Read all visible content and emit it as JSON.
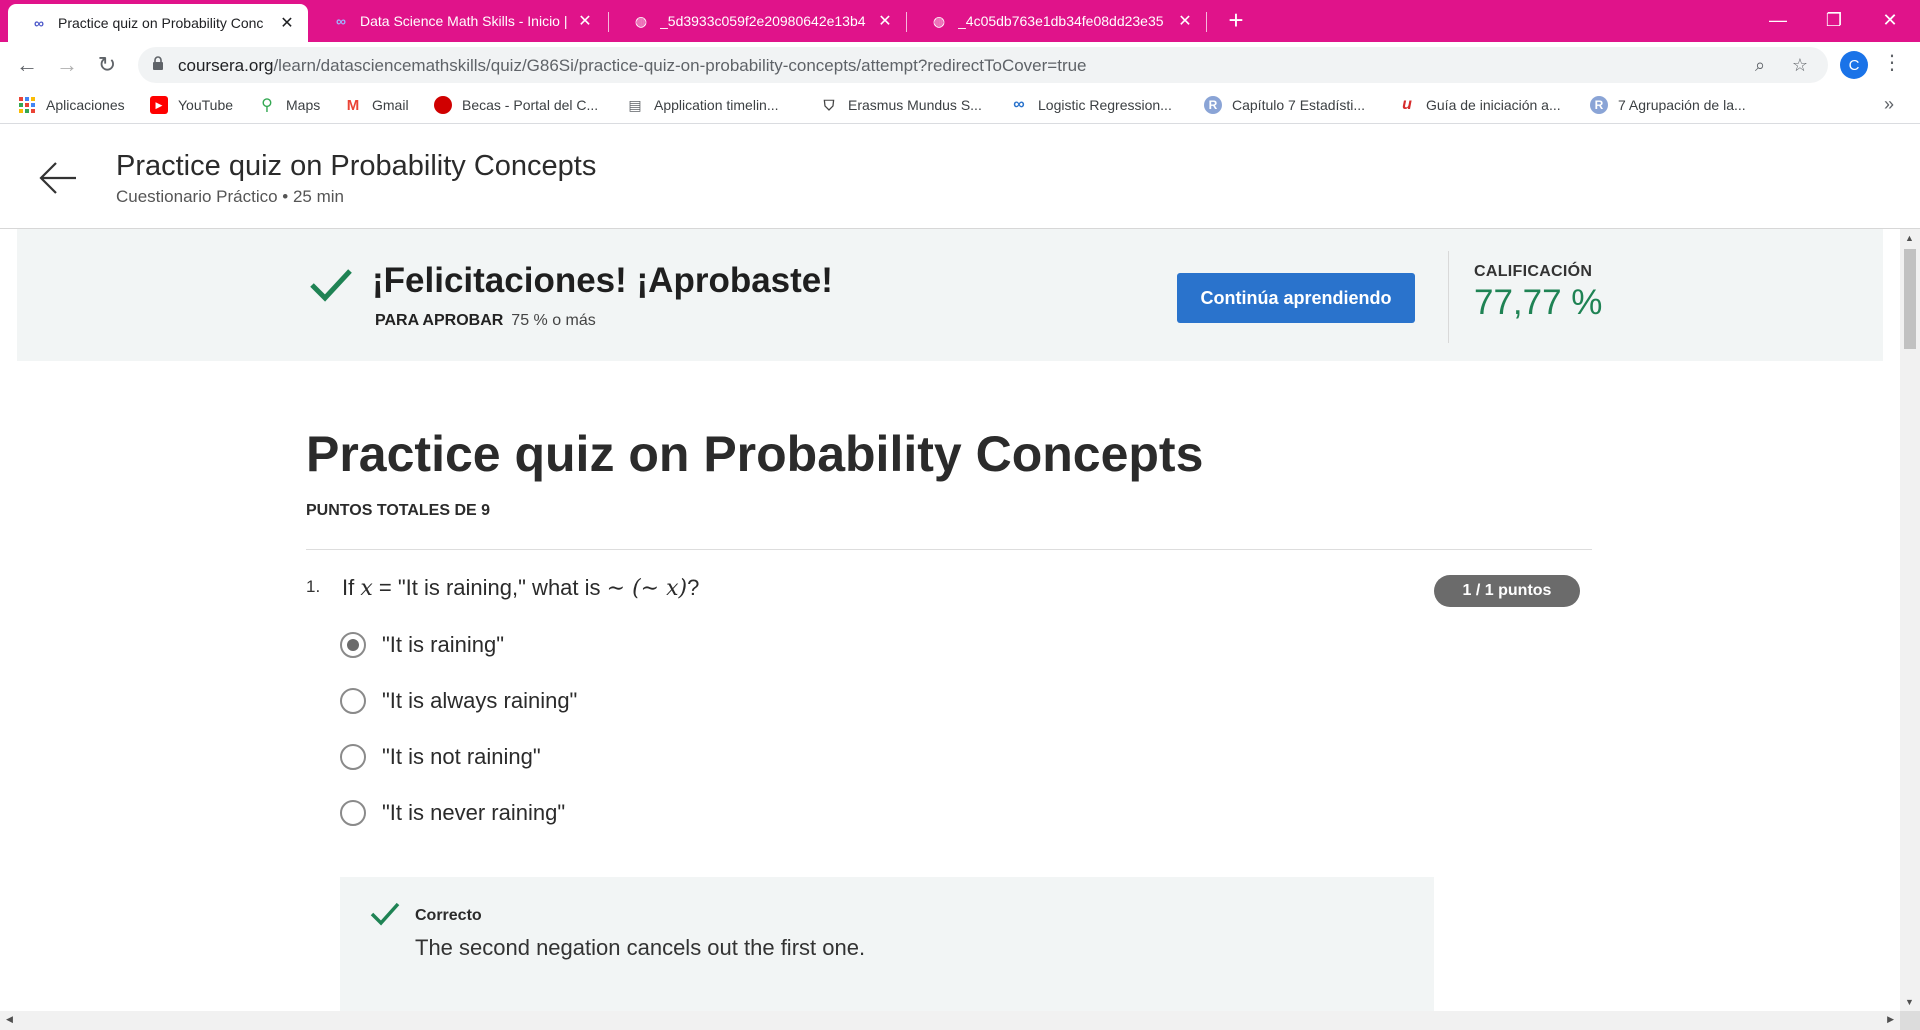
{
  "browser": {
    "tabs": [
      {
        "title": "Practice quiz on Probability Conc",
        "icon": "coursera-icon",
        "active": true
      },
      {
        "title": "Data Science Math Skills - Inicio |",
        "icon": "coursera-icon",
        "active": false
      },
      {
        "title": "_5d3933c059f2e20980642e13b4",
        "icon": "globe-icon",
        "active": false
      },
      {
        "title": "_4c05db763e1db34fe08dd23e35",
        "icon": "globe-icon",
        "active": false
      }
    ],
    "url_host": "coursera.org",
    "url_path": "/learn/datasciencemathskills/quiz/G86Si/practice-quiz-on-probability-concepts/attempt?redirectToCover=true",
    "profile_initial": "C",
    "accent_color": "#e0138a"
  },
  "bookmarks": [
    {
      "label": "Aplicaciones",
      "icon": "apps-grid-icon"
    },
    {
      "label": "YouTube",
      "icon": "youtube-icon"
    },
    {
      "label": "Maps",
      "icon": "maps-pin-icon"
    },
    {
      "label": "Gmail",
      "icon": "gmail-icon"
    },
    {
      "label": "Becas - Portal del C...",
      "icon": "red-circle-icon"
    },
    {
      "label": "Application timelin...",
      "icon": "document-icon"
    },
    {
      "label": "Erasmus Mundus S...",
      "icon": "shield-icon"
    },
    {
      "label": "Logistic Regression...",
      "icon": "coursera-icon"
    },
    {
      "label": "Capítulo 7 Estadísti...",
      "icon": "r-circle-icon"
    },
    {
      "label": "Guía de iniciación a...",
      "icon": "u-logo-icon"
    },
    {
      "label": "7 Agrupación de la...",
      "icon": "r-circle-icon"
    }
  ],
  "header": {
    "title": "Practice quiz on Probability Concepts",
    "subtitle": "Cuestionario Práctico • 25 min"
  },
  "result": {
    "headline": "¡Felicitaciones! ¡Aprobaste!",
    "pass_label": "PARA APROBAR",
    "pass_value": "75 % o más",
    "cta": "Continúa aprendiendo",
    "grade_label": "CALIFICACIÓN",
    "grade_value": "77,77 %",
    "grade_color": "#1f8354"
  },
  "quiz": {
    "title": "Practice quiz on Probability Concepts",
    "total_points": "PUNTOS TOTALES DE 9"
  },
  "question1": {
    "number": "1.",
    "text_prefix": "If ",
    "math_var": "x",
    "text_mid": " = \"It is raining,\" what is ",
    "math_expr": "∼ (∼ x)",
    "text_suffix": "?",
    "score": "1 / 1 puntos",
    "options": [
      {
        "label": "\"It is raining\"",
        "selected": true
      },
      {
        "label": "\"It is always raining\"",
        "selected": false
      },
      {
        "label": "\"It is not raining\"",
        "selected": false
      },
      {
        "label": "\"It is never raining\"",
        "selected": false
      }
    ],
    "feedback_label": "Correcto",
    "feedback_text": "The second negation cancels out the first one."
  }
}
